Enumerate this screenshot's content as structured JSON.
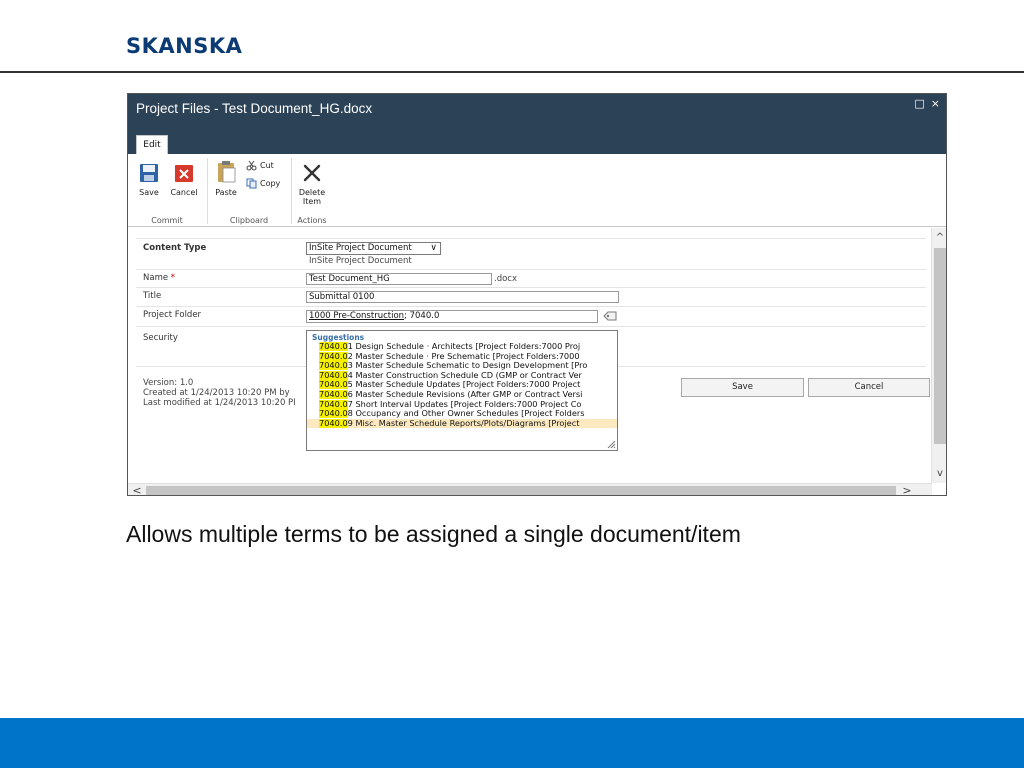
{
  "slide": {
    "logo": "SKANSKA",
    "caption": "Allows multiple terms to be assigned a single document/item"
  },
  "dialog": {
    "title": "Project Files - Test Document_HG.docx",
    "maximize_glyph": "□",
    "close_glyph": "×",
    "tab_edit": "Edit"
  },
  "ribbon": {
    "save": "Save",
    "cancel": "Cancel",
    "paste": "Paste",
    "cut": "Cut",
    "copy": "Copy",
    "delete_line1": "Delete",
    "delete_line2": "Item",
    "group_commit": "Commit",
    "group_clipboard": "Clipboard",
    "group_actions": "Actions"
  },
  "form": {
    "content_type_label": "Content Type",
    "content_type_value": "InSite Project Document",
    "content_type_desc": "InSite Project Document",
    "name_label": "Name",
    "name_required": "*",
    "name_value": "Test Document_HG",
    "name_ext": ".docx",
    "title_label": "Title",
    "title_value": "Submittal 0100",
    "folder_label": "Project Folder",
    "folder_term": "1000 Pre-Construction",
    "folder_rest": "; 7040.0",
    "security_label": "Security",
    "version": "Version: 1.0",
    "created": "Created at 1/24/2013 10:20 PM by",
    "modified": "Last modified at 1/24/2013 10:20 PI",
    "save_button": "Save",
    "cancel_button": "Cancel"
  },
  "suggestions": {
    "header": "Suggestions",
    "items": [
      {
        "hl": "7040.0",
        "rest": "1 Design Schedule · Architects [Project Folders:7000 Proj"
      },
      {
        "hl": "7040.0",
        "rest": "2 Master Schedule · Pre Schematic [Project Folders:7000"
      },
      {
        "hl": "7040.0",
        "rest": "3 Master Schedule Schematic to Design Development [Pro"
      },
      {
        "hl": "7040.0",
        "rest": "4 Master Construction Schedule CD (GMP or Contract Ver"
      },
      {
        "hl": "7040.0",
        "rest": "5 Master Schedule Updates [Project Folders:7000 Project"
      },
      {
        "hl": "7040.0",
        "rest": "6 Master Schedule Revisions (After GMP or Contract Versi"
      },
      {
        "hl": "7040.0",
        "rest": "7 Short Interval Updates [Project Folders:7000 Project Co"
      },
      {
        "hl": "7040.0",
        "rest": "8 Occupancy and Other Owner Schedules [Project Folders"
      },
      {
        "hl": "7040.0",
        "rest": "9 Misc. Master Schedule Reports/Plots/Diagrams [Project"
      }
    ]
  },
  "scrollbars": {
    "up": "^",
    "down": "v",
    "left": "<",
    "right": ">"
  },
  "colors": {
    "brand_blue": "#0074c8",
    "logo_navy": "#0b3b74",
    "titlebar": "#2c4357",
    "highlight": "#f5f000"
  }
}
